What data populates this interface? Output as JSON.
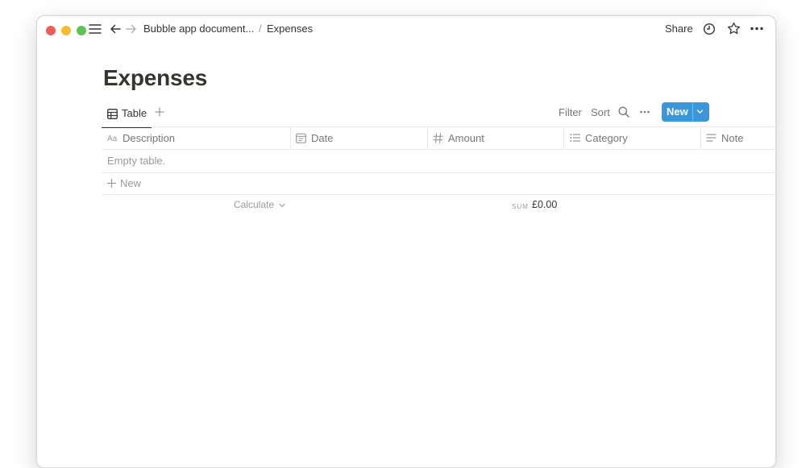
{
  "titlebar": {
    "breadcrumb_parent": "Bubble app document...",
    "breadcrumb_separator": "/",
    "breadcrumb_current": "Expenses",
    "share_label": "Share"
  },
  "page": {
    "title": "Expenses"
  },
  "views": {
    "active_tab": "Table"
  },
  "toolbar": {
    "filter_label": "Filter",
    "sort_label": "Sort",
    "new_label": "New",
    "accent_color": "#3a97d9"
  },
  "table": {
    "columns": [
      {
        "label": "Description",
        "icon": "text-property-icon"
      },
      {
        "label": "Date",
        "icon": "calendar-icon"
      },
      {
        "label": "Amount",
        "icon": "number-hash-icon"
      },
      {
        "label": "Category",
        "icon": "list-icon"
      },
      {
        "label": "Note",
        "icon": "text-lines-icon"
      }
    ],
    "empty_message": "Empty table.",
    "add_row_label": "New",
    "calculate_label": "Calculate",
    "sum_label": "SUM",
    "sum_value": "£0.00"
  }
}
